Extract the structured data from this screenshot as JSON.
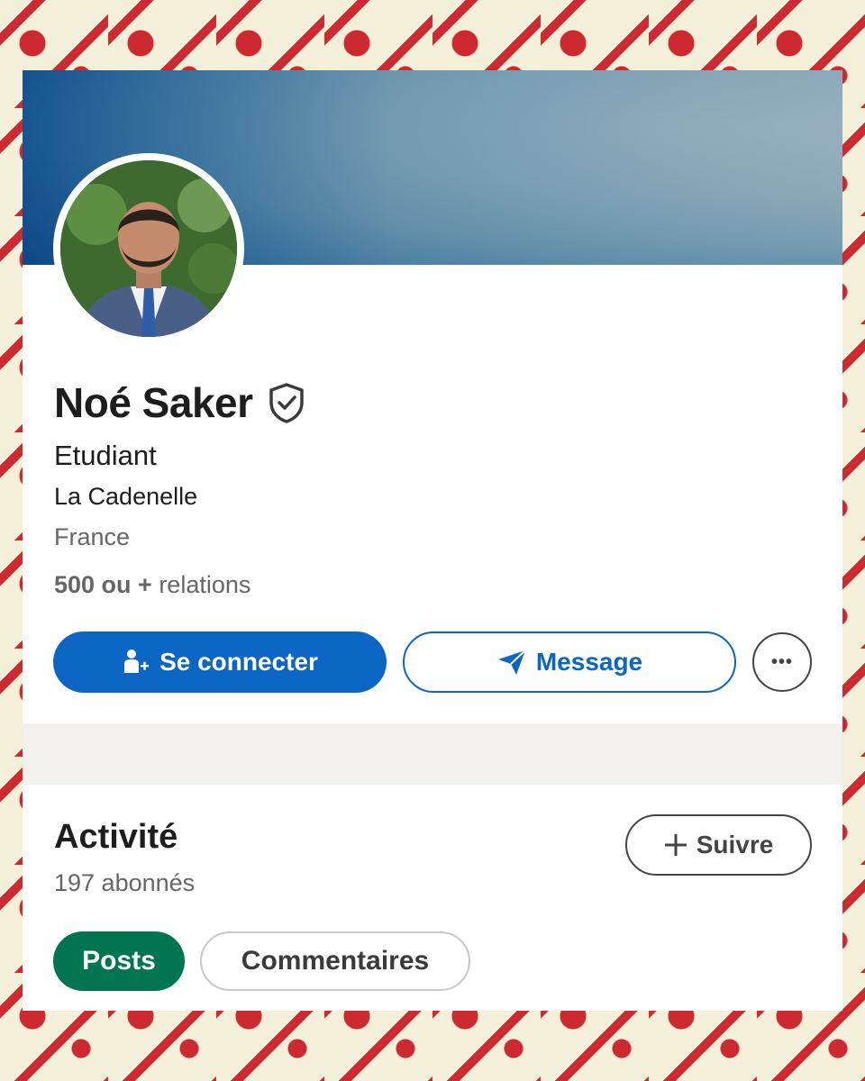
{
  "profile": {
    "name": "Noé Saker",
    "headline": "Etudiant",
    "company": "La Cadenelle",
    "location": "France",
    "connections_count": "500 ou +",
    "connections_label": " relations"
  },
  "actions": {
    "connect_label": "Se connecter",
    "message_label": "Message",
    "more_label": "•••"
  },
  "activity": {
    "title": "Activité",
    "followers": "197 abonnés",
    "follow_label": "Suivre",
    "tabs": [
      {
        "label": "Posts",
        "selected": true
      },
      {
        "label": "Commentaires",
        "selected": false
      }
    ]
  },
  "colors": {
    "brand_blue": "#0a66c2",
    "posts_green": "#01754f",
    "frame_red": "#cc2a30",
    "frame_cream": "#f3efd9"
  },
  "icons": {
    "verified": "verified-shield-icon",
    "connect": "add-person-icon",
    "message": "send-icon",
    "more": "more-dots-icon",
    "follow": "plus-icon"
  }
}
